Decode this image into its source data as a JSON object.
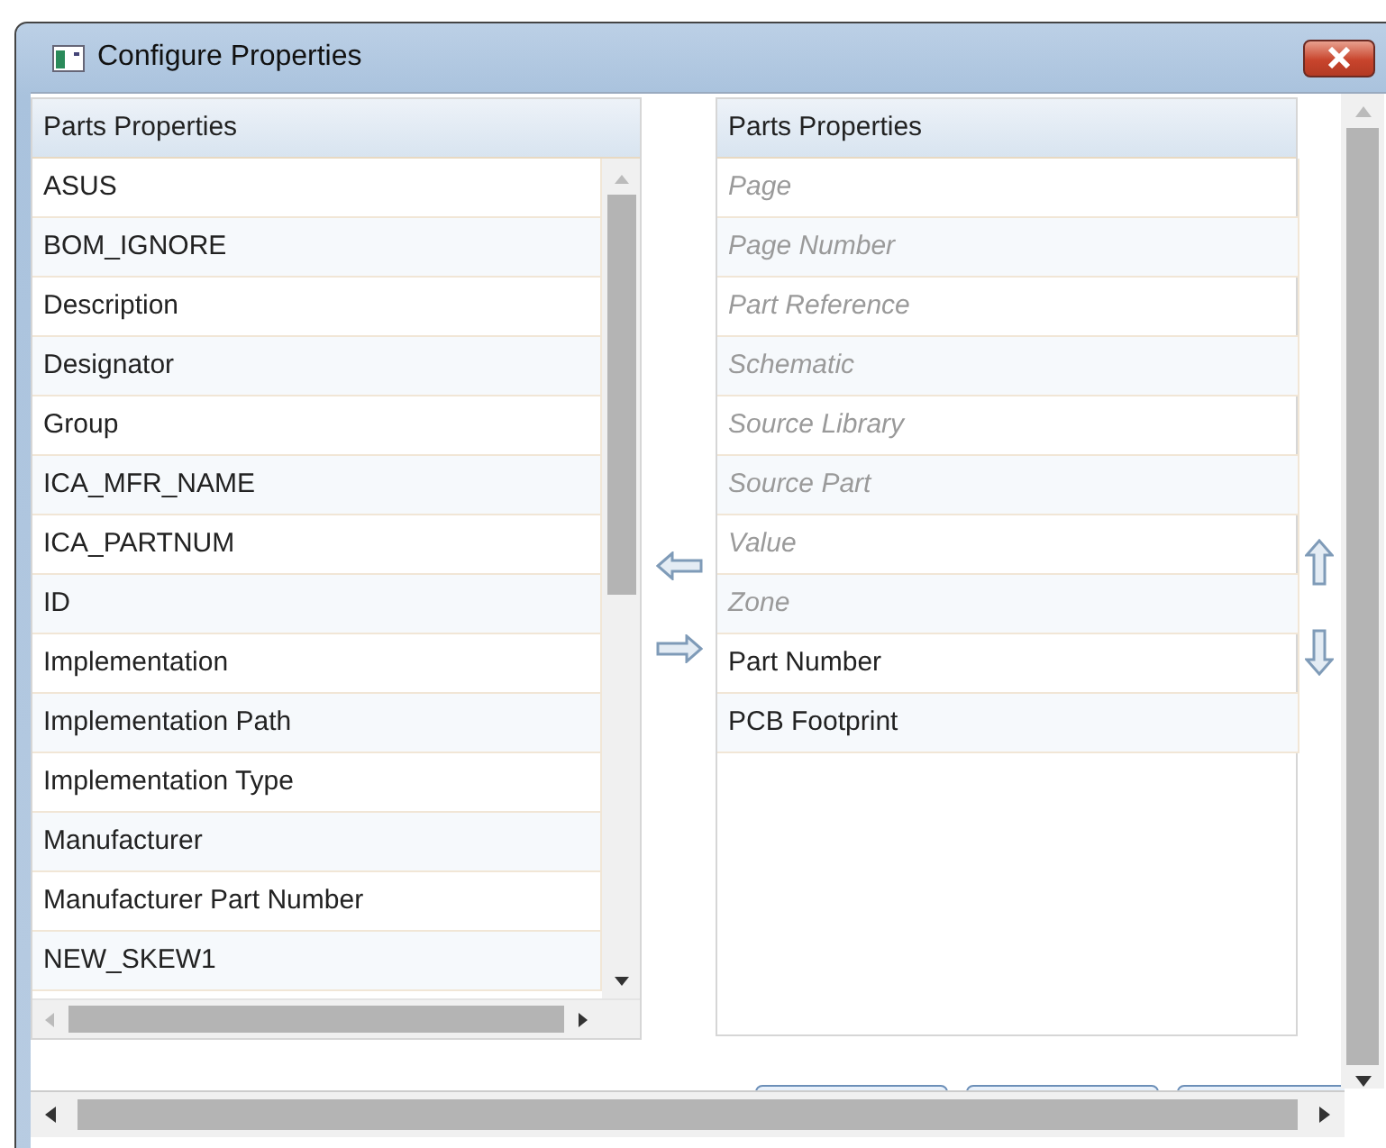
{
  "window": {
    "title": "Configure Properties"
  },
  "available": {
    "header": "Parts Properties",
    "items": [
      {
        "label": "ASUS"
      },
      {
        "label": "BOM_IGNORE"
      },
      {
        "label": "Description"
      },
      {
        "label": "Designator"
      },
      {
        "label": "Group"
      },
      {
        "label": "ICA_MFR_NAME"
      },
      {
        "label": "ICA_PARTNUM"
      },
      {
        "label": "ID"
      },
      {
        "label": "Implementation"
      },
      {
        "label": "Implementation Path"
      },
      {
        "label": "Implementation Type"
      },
      {
        "label": "Manufacturer"
      },
      {
        "label": "Manufacturer Part Number"
      },
      {
        "label": "NEW_SKEW1"
      }
    ]
  },
  "selected_props": {
    "header": "Parts Properties",
    "items": [
      {
        "label": "Page",
        "disabled": true
      },
      {
        "label": "Page Number",
        "disabled": true
      },
      {
        "label": "Part Reference",
        "disabled": true
      },
      {
        "label": "Schematic",
        "disabled": true
      },
      {
        "label": "Source Library",
        "disabled": true
      },
      {
        "label": "Source Part",
        "disabled": true
      },
      {
        "label": "Value",
        "disabled": true
      },
      {
        "label": "Zone",
        "disabled": true
      },
      {
        "label": "Part Number",
        "disabled": false
      },
      {
        "label": "PCB Footprint",
        "disabled": false
      }
    ]
  }
}
